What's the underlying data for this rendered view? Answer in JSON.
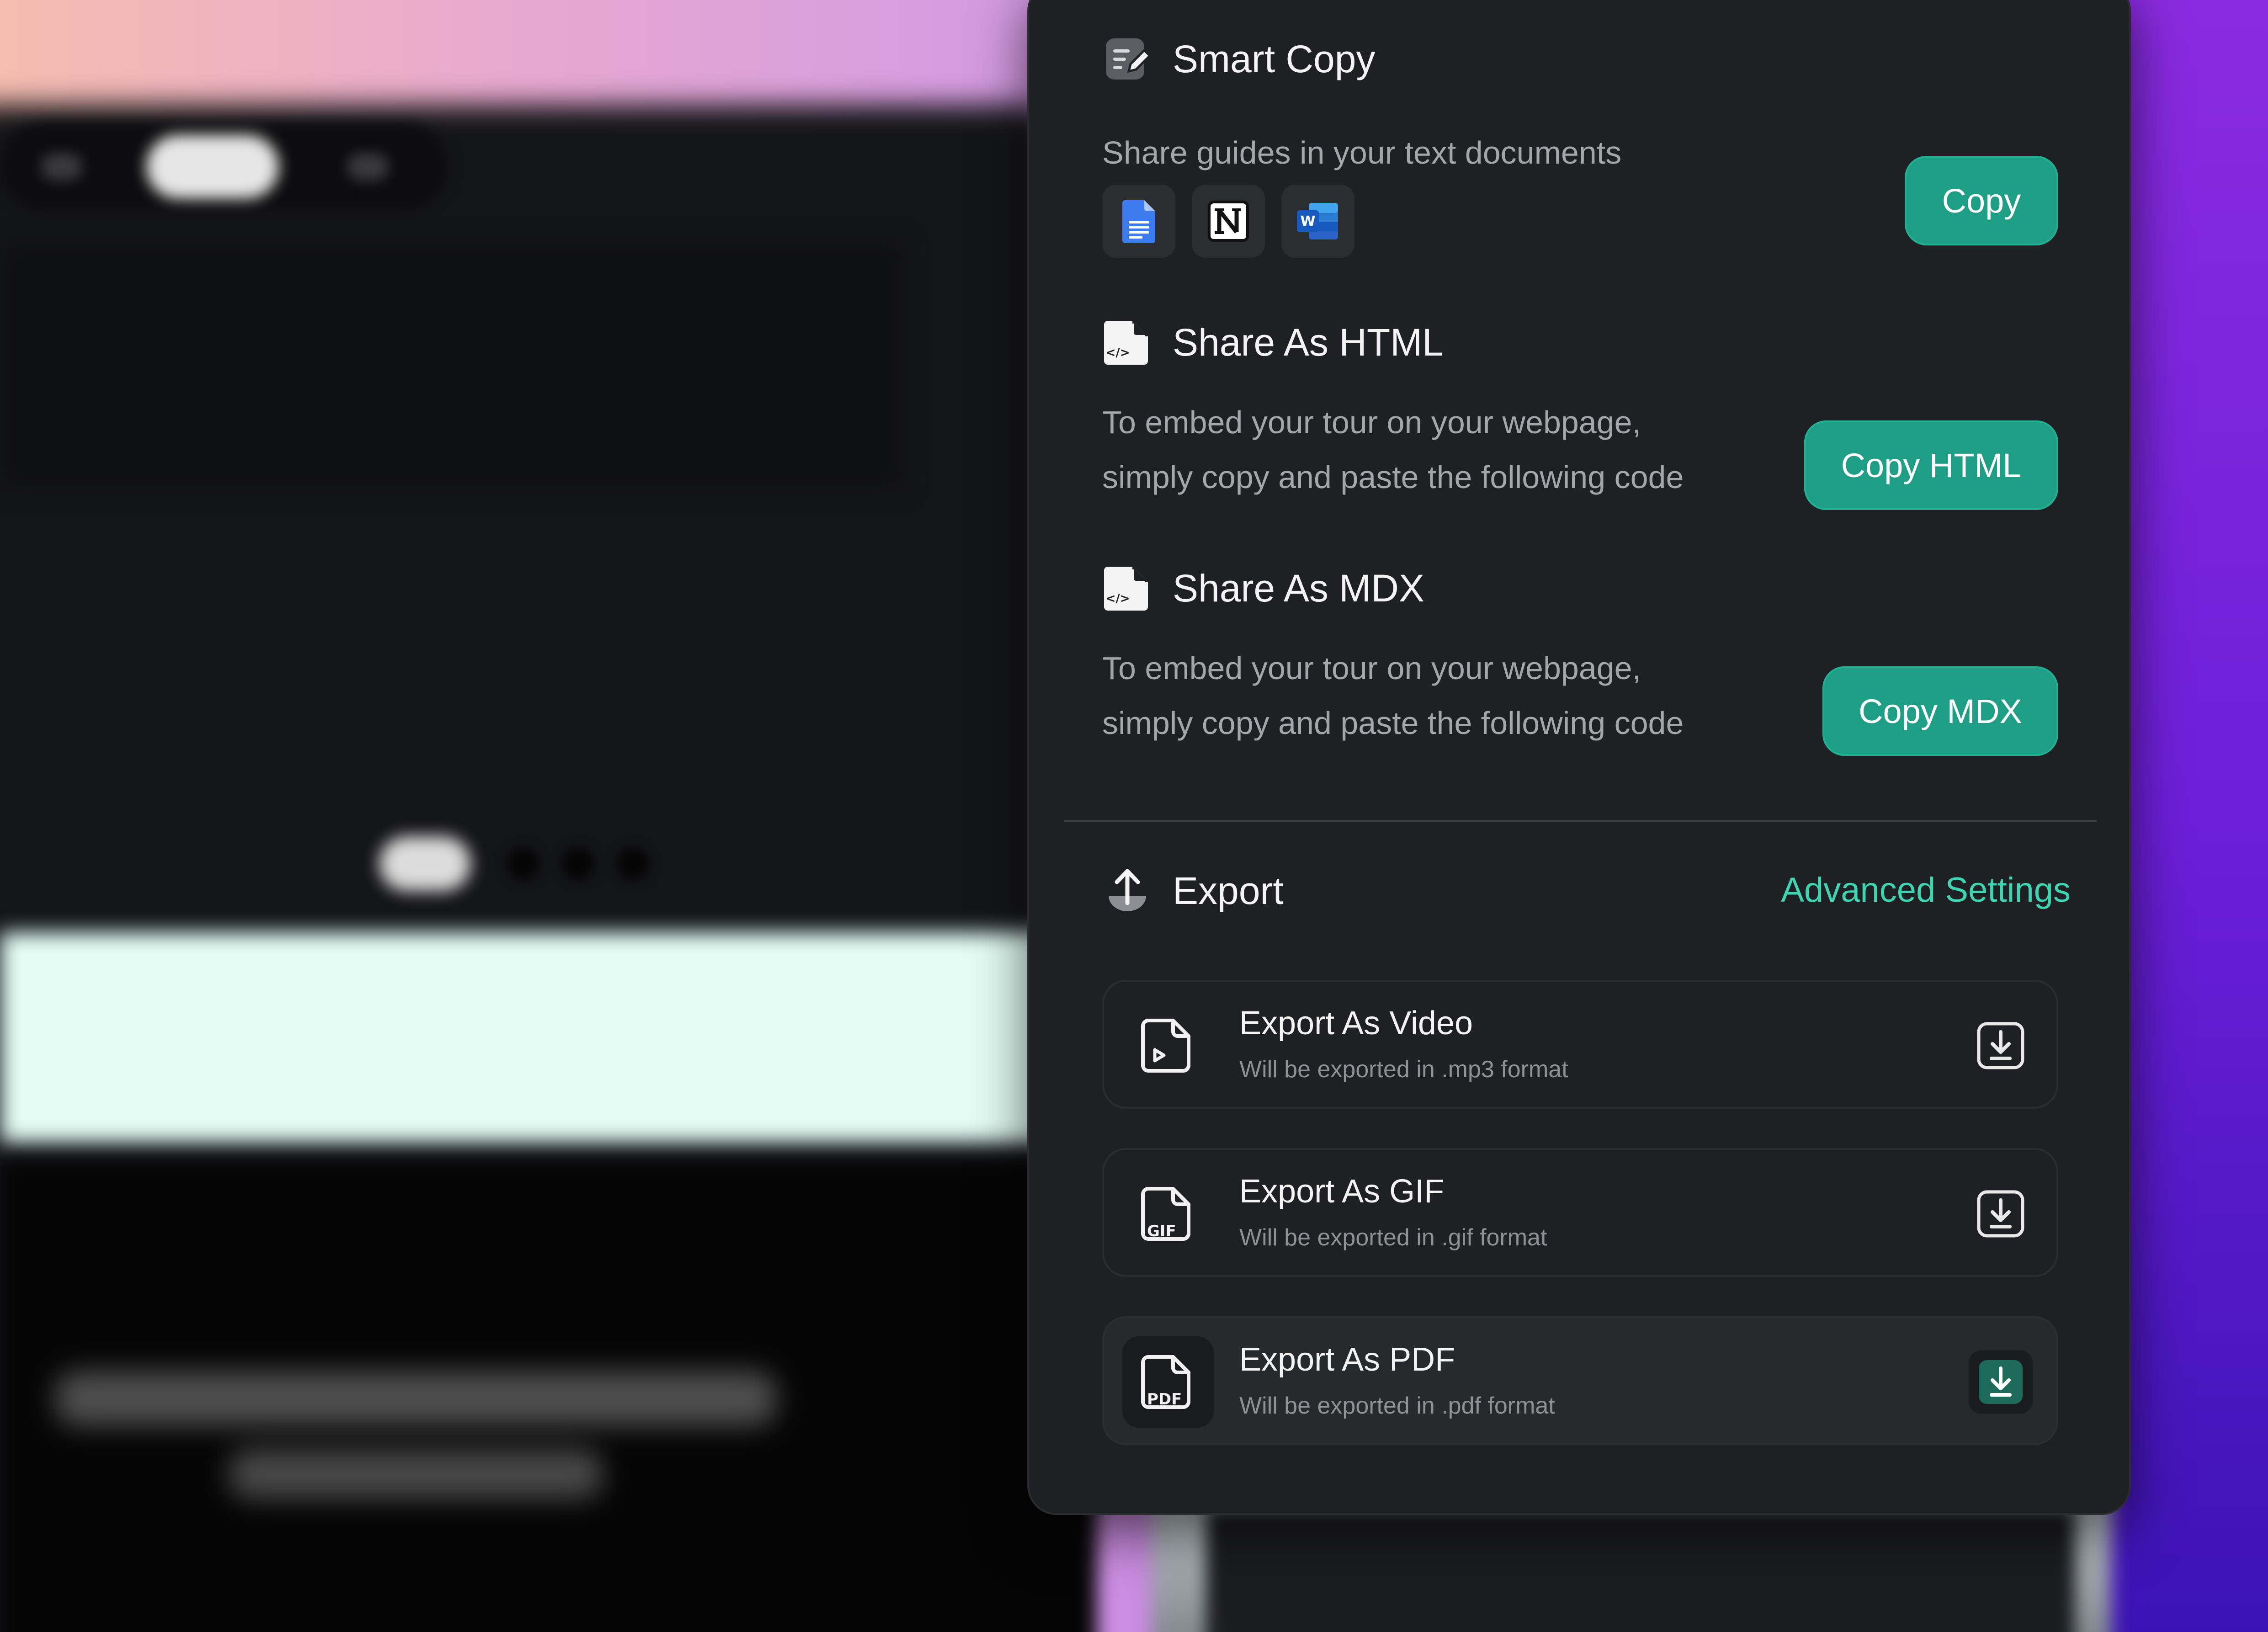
{
  "smart_copy": {
    "title": "Smart Copy",
    "description": "Share guides in your text documents",
    "button": "Copy",
    "apps": [
      "google-docs-icon",
      "notion-icon",
      "word-icon"
    ]
  },
  "share_html": {
    "title": "Share As HTML",
    "description_line1": "To embed your tour on your webpage,",
    "description_line2": "simply copy and paste the following code",
    "button": "Copy HTML"
  },
  "share_mdx": {
    "title": "Share As MDX",
    "description_line1": "To embed your tour on your webpage,",
    "description_line2": "simply copy and paste the following code",
    "button": "Copy MDX"
  },
  "export": {
    "title": "Export",
    "advanced_link": "Advanced Settings",
    "items": [
      {
        "title": "Export As Video",
        "subtitle": "Will be exported in .mp3 format",
        "icon": "video-file-icon",
        "active": false
      },
      {
        "title": "Export As GIF",
        "subtitle": "Will be exported in .gif format",
        "icon": "gif-file-icon",
        "badge": "GIF",
        "active": false
      },
      {
        "title": "Export As PDF",
        "subtitle": "Will be exported in .pdf format",
        "icon": "pdf-file-icon",
        "badge": "PDF",
        "active": true
      }
    ]
  },
  "colors": {
    "accent": "#1e9e84",
    "link": "#3ed5b2",
    "panel": "#1f2023"
  }
}
